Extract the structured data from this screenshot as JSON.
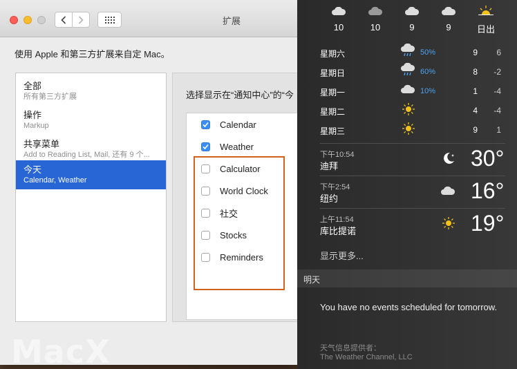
{
  "window": {
    "title": "扩展",
    "intro": "使用 Apple 和第三方扩展来自定 Mac。"
  },
  "sidebar": {
    "items": [
      {
        "title": "全部",
        "subtitle": "所有第三方扩展"
      },
      {
        "title": "操作",
        "subtitle": "Markup"
      },
      {
        "title": "共享菜单",
        "subtitle": "Add to Reading List, Mail, 还有 9 个..."
      },
      {
        "title": "今天",
        "subtitle": "Calendar, Weather",
        "selected": true
      }
    ]
  },
  "panel": {
    "label": "选择显示在“通知中心”的“今",
    "extensions": [
      {
        "label": "Calendar",
        "checked": true
      },
      {
        "label": "Weather",
        "checked": true
      },
      {
        "label": "Calculator",
        "checked": false
      },
      {
        "label": "World Clock",
        "checked": false
      },
      {
        "label": "社交",
        "checked": false
      },
      {
        "label": "Stocks",
        "checked": false
      },
      {
        "label": "Reminders",
        "checked": false
      }
    ],
    "highlight_color": "#d2611e"
  },
  "watermark": "MacX",
  "notification_center": {
    "hourly": [
      {
        "value": "10",
        "icon": "cloud-icon"
      },
      {
        "value": "10",
        "icon": "cloud-icon"
      },
      {
        "value": "9",
        "icon": "cloud-icon"
      },
      {
        "value": "9",
        "icon": "cloud-icon"
      },
      {
        "value": "日出",
        "icon": "sunrise-icon"
      }
    ],
    "daily": [
      {
        "day": "星期六",
        "icon": "rain-icon",
        "pct": "50%",
        "hi": "9",
        "lo": "6"
      },
      {
        "day": "星期日",
        "icon": "rain-icon",
        "pct": "60%",
        "hi": "8",
        "lo": "-2"
      },
      {
        "day": "星期一",
        "icon": "cloud-icon",
        "pct": "10%",
        "hi": "1",
        "lo": "-4"
      },
      {
        "day": "星期二",
        "icon": "sun-icon",
        "pct": "",
        "hi": "4",
        "lo": "-4"
      },
      {
        "day": "星期三",
        "icon": "sun-icon",
        "pct": "",
        "hi": "9",
        "lo": "1"
      }
    ],
    "cities": [
      {
        "time": "下午10:54",
        "name": "迪拜",
        "icon": "moon-icon",
        "temp": "30°"
      },
      {
        "time": "下午2:54",
        "name": "纽约",
        "icon": "cloud-icon",
        "temp": "16°"
      },
      {
        "time": "上午11:54",
        "name": "库比提诺",
        "icon": "sun-icon",
        "temp": "19°"
      }
    ],
    "show_more": "显示更多...",
    "tomorrow_header": "明天",
    "events_text": "You have no events scheduled for tomorrow.",
    "provider_label": "天气信息提供者：",
    "provider_name": "The Weather Channel, LLC",
    "accent_color": "#4ea3f0"
  }
}
